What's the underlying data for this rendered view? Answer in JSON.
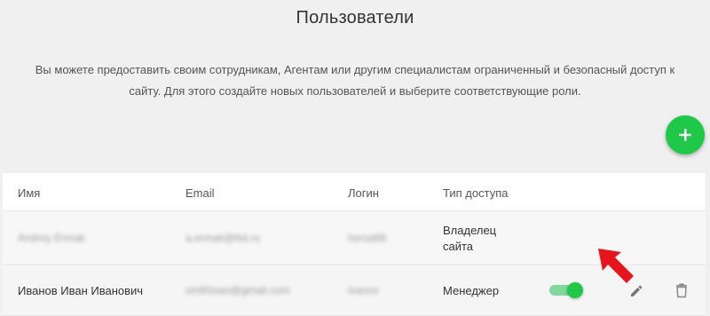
{
  "page": {
    "title": "Пользователи",
    "description_line1": "Вы можете предоставить своим сотрудникам, Агентам или другим специалистам ограниченный и безопасный доступ к",
    "description_line2": "сайту. Для этого создайте новых пользователей и выберите соответствующие роли."
  },
  "add_button": {
    "icon": "plus-icon",
    "color": "#1ec947"
  },
  "table": {
    "columns": [
      "Имя",
      "Email",
      "Логин",
      "Тип доступа"
    ],
    "rows": [
      {
        "name": "Andrey Ermak",
        "email": "a.ermak@list.ru",
        "login": "horsa86",
        "access_line1": "Владелец",
        "access_line2": "сайта"
      },
      {
        "name": "Иванов Иван Иванович",
        "email": "smithivan@gmail.com",
        "login": "ivanov",
        "access": "Менеджер",
        "active": true
      }
    ]
  },
  "colors": {
    "accent": "#1ec947",
    "arrow": "#e8141c"
  },
  "icons": {
    "edit": "pencil-icon",
    "delete": "trash-icon",
    "pointer": "red-arrow-icon"
  }
}
